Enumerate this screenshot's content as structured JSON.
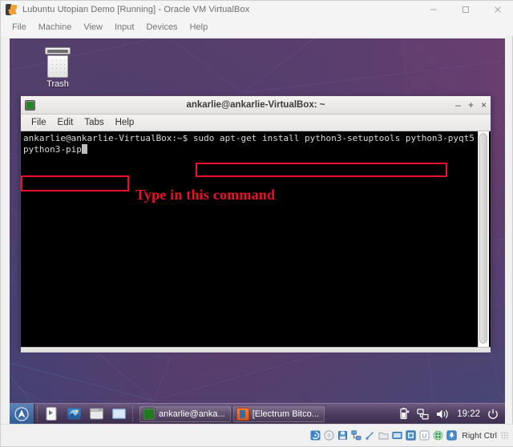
{
  "host_window": {
    "title": "Lubuntu Utopian Demo [Running] - Oracle VM VirtualBox",
    "app_icon": "virtualbox-icon",
    "window_buttons": {
      "minimize": "minimize-icon",
      "maximize": "maximize-icon",
      "close": "close-icon"
    },
    "menu": [
      {
        "label": "File"
      },
      {
        "label": "Machine"
      },
      {
        "label": "View"
      },
      {
        "label": "Input"
      },
      {
        "label": "Devices"
      },
      {
        "label": "Help"
      }
    ]
  },
  "desktop": {
    "icons": [
      {
        "label": "Trash",
        "icon": "trash-icon"
      }
    ],
    "wallpaper_colors": {
      "top_left": "#51406b",
      "top_right": "#6b3e69",
      "bottom_left": "#3d4a77",
      "bottom_right": "#5a3a66"
    }
  },
  "terminal": {
    "title": "ankarlie@ankarlie-VirtualBox: ~",
    "app_icon": "terminal-icon",
    "window_buttons": {
      "minimize": "–",
      "maximize": "+",
      "close": "×"
    },
    "menu": [
      {
        "label": "File"
      },
      {
        "label": "Edit"
      },
      {
        "label": "Tabs"
      },
      {
        "label": "Help"
      }
    ],
    "prompt": "ankarlie@ankarlie-VirtualBox:~$ ",
    "command": "sudo apt-get install python3-setuptools python3-pyqt5 python3-pip",
    "cursor": "block-cursor",
    "background": "#000000",
    "foreground": "#d8d8d8"
  },
  "annotations": {
    "color": "#e8102a",
    "callout_text": "Type in this command",
    "boxes": [
      {
        "name": "command-line-1-highlight"
      },
      {
        "name": "command-line-2-highlight"
      }
    ]
  },
  "taskbar": {
    "start_menu": {
      "icon": "lubuntu-start-icon"
    },
    "launchers": [
      {
        "icon": "file-manager-icon",
        "name": "file-manager"
      },
      {
        "icon": "web-browser-icon",
        "name": "web-browser"
      },
      {
        "icon": "terminal-launcher-icon",
        "name": "terminal"
      },
      {
        "icon": "show-desktop-icon",
        "name": "show-desktop"
      }
    ],
    "windows": [
      {
        "title": "ankarlie@anka...",
        "icon": "terminal-icon",
        "active": true
      },
      {
        "title": "[Electrum Bitco...",
        "icon": "electrum-icon",
        "active": false
      }
    ],
    "tray": [
      {
        "icon": "battery-icon",
        "name": "battery"
      },
      {
        "icon": "network-icon",
        "name": "network"
      },
      {
        "icon": "volume-icon",
        "name": "volume"
      }
    ],
    "clock": "19:22",
    "power": {
      "icon": "power-icon"
    }
  },
  "vbox_statusbar": {
    "icons": [
      {
        "name": "hard-disk-icon"
      },
      {
        "name": "optical-disk-icon"
      },
      {
        "name": "floppy-disk-icon"
      },
      {
        "name": "network-adapter-icon"
      },
      {
        "name": "usb-icon"
      },
      {
        "name": "shared-folders-icon"
      },
      {
        "name": "display-icon"
      },
      {
        "name": "recording-icon"
      },
      {
        "name": "guest-additions-icon"
      },
      {
        "name": "mouse-integration-icon"
      },
      {
        "name": "host-key-icon"
      }
    ],
    "host_key_label": "Right Ctrl"
  }
}
